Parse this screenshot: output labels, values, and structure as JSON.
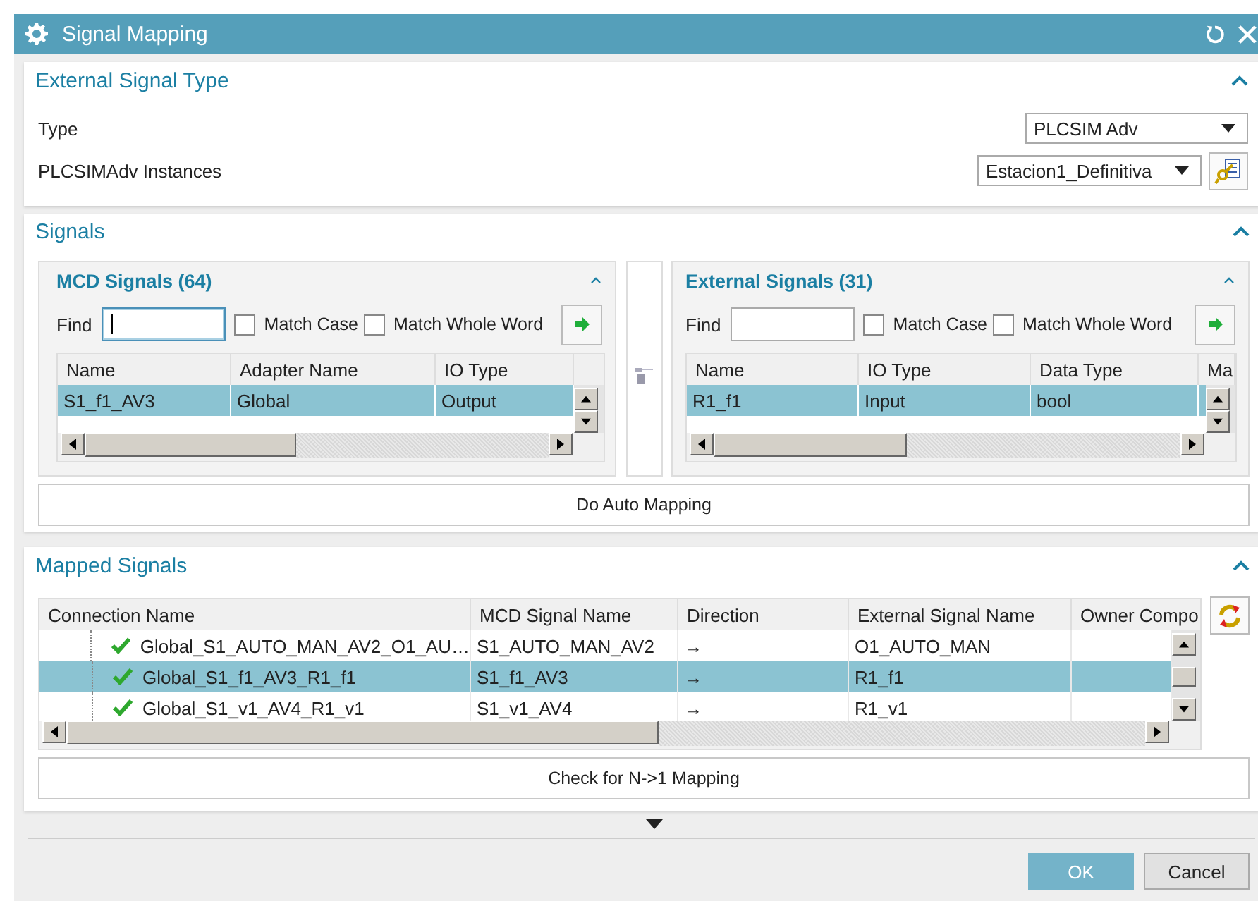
{
  "window": {
    "title": "Signal Mapping"
  },
  "external_signal_type": {
    "title": "External Signal Type",
    "expanded": true,
    "fields": [
      {
        "label": "Type",
        "value": "PLCSIM Adv",
        "has_button": false
      },
      {
        "label": "PLCSIMAdv Instances",
        "value": "Estacion1_Definitiva",
        "has_button": true
      }
    ]
  },
  "signals": {
    "title": "Signals",
    "expanded": true,
    "panels": [
      {
        "title": "MCD Signals (64)",
        "expanded": true,
        "find_label": "Find",
        "focused": true,
        "options": [
          {
            "label": "Match Case",
            "checked": false
          },
          {
            "label": "Match Whole Word",
            "checked": false
          }
        ],
        "columns": [
          "Name",
          "Adapter Name",
          "IO Type"
        ],
        "rows": [
          {
            "cells": [
              "S1_f1_AV3",
              "Global",
              "Output"
            ],
            "selected": true
          }
        ]
      },
      {
        "title": "External Signals (31)",
        "expanded": true,
        "find_label": "Find",
        "focused": false,
        "options": [
          {
            "label": "Match Case",
            "checked": false
          },
          {
            "label": "Match Whole Word",
            "checked": false
          }
        ],
        "columns": [
          "Name",
          "IO Type",
          "Data Type",
          "Ma"
        ],
        "rows": [
          {
            "cells": [
              "R1_f1",
              "Input",
              "bool"
            ],
            "selected": true
          }
        ]
      }
    ],
    "auto_mapping_button": "Do Auto Mapping"
  },
  "mapped_signals": {
    "title": "Mapped Signals",
    "expanded": true,
    "columns": [
      "Connection Name",
      "MCD Signal Name",
      "Direction",
      "External Signal Name",
      "Owner Compo"
    ],
    "rows": [
      {
        "mapped": true,
        "cells": [
          "Global_S1_AUTO_MAN_AV2_O1_AU…",
          "S1_AUTO_MAN_AV2",
          "→",
          "O1_AUTO_MAN"
        ],
        "selected": false
      },
      {
        "mapped": true,
        "cells": [
          "Global_S1_f1_AV3_R1_f1",
          "S1_f1_AV3",
          "→",
          "R1_f1"
        ],
        "selected": true
      },
      {
        "mapped": true,
        "cells": [
          "Global_S1_v1_AV4_R1_v1",
          "S1_v1_AV4",
          "→",
          "R1_v1"
        ],
        "selected": false
      }
    ],
    "check_button": "Check for N->1 Mapping"
  },
  "buttons": [
    {
      "label": "OK",
      "kind": "primary"
    },
    {
      "label": "Cancel",
      "kind": "normal"
    }
  ]
}
